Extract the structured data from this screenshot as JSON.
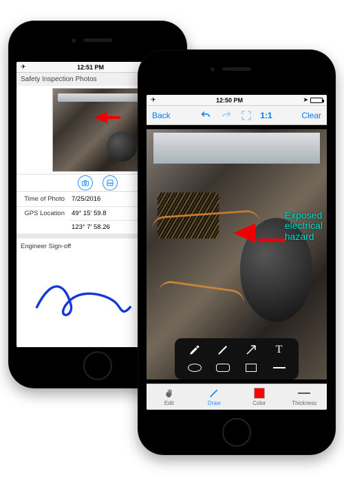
{
  "phoneA": {
    "statusbar": {
      "time": "12:51 PM"
    },
    "pageTitle": "Safety Inspection Photos",
    "form": {
      "timeOfPhoto": {
        "label": "Time of Photo",
        "value": "7/25/2016"
      },
      "gps": {
        "label": "GPS Location",
        "lat": "49° 15' 59.8",
        "lon": "123° 7' 58.26"
      },
      "signoff": {
        "label": "Engineer Sign-off"
      }
    }
  },
  "phoneB": {
    "statusbar": {
      "time": "12:50 PM"
    },
    "toolbar": {
      "back": "Back",
      "oneToOne": "1:1",
      "clear": "Clear"
    },
    "annotation": {
      "line1": "Exposed",
      "line2": "electrical",
      "line3": "hazard"
    },
    "tabs": {
      "edit": "Edit",
      "draw": "Draw",
      "color": "Color",
      "thickness": "Thickness"
    }
  }
}
